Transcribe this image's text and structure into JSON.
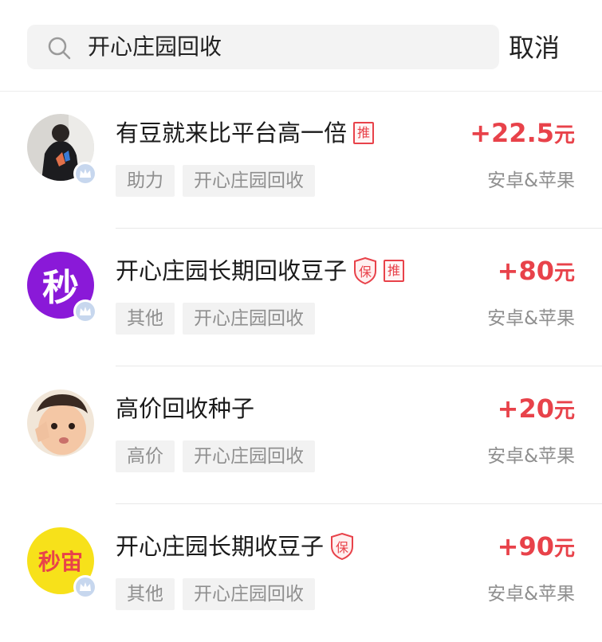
{
  "search": {
    "query": "开心庄园回收",
    "cancel_label": "取消"
  },
  "badges": {
    "recommend": "推",
    "guarantee": "保"
  },
  "items": [
    {
      "title": "有豆就来比平台高一倍",
      "recommended": true,
      "guaranteed": false,
      "price": "+22.5",
      "unit": "元",
      "tags": [
        "助力",
        "开心庄园回收"
      ],
      "platform": "安卓&苹果",
      "avatar": {
        "kind": "photo"
      }
    },
    {
      "title": "开心庄园长期回收豆子",
      "recommended": true,
      "guaranteed": true,
      "price": "+80",
      "unit": "元",
      "tags": [
        "其他",
        "开心庄园回收"
      ],
      "platform": "安卓&苹果",
      "avatar": {
        "kind": "text",
        "text": "秒",
        "color": "#8a19d8",
        "text_color": "#ffffff"
      }
    },
    {
      "title": "高价回收种子",
      "recommended": false,
      "guaranteed": false,
      "price": "+20",
      "unit": "元",
      "tags": [
        "高价",
        "开心庄园回收"
      ],
      "platform": "安卓&苹果",
      "avatar": {
        "kind": "photo"
      }
    },
    {
      "title": "开心庄园长期收豆子",
      "recommended": false,
      "guaranteed": true,
      "price": "+90",
      "unit": "元",
      "tags": [
        "其他",
        "开心庄园回收"
      ],
      "platform": "安卓&苹果",
      "avatar": {
        "kind": "text",
        "text": "秒宙",
        "color": "#f7e11a",
        "text_color": "#e8424a"
      }
    }
  ]
}
